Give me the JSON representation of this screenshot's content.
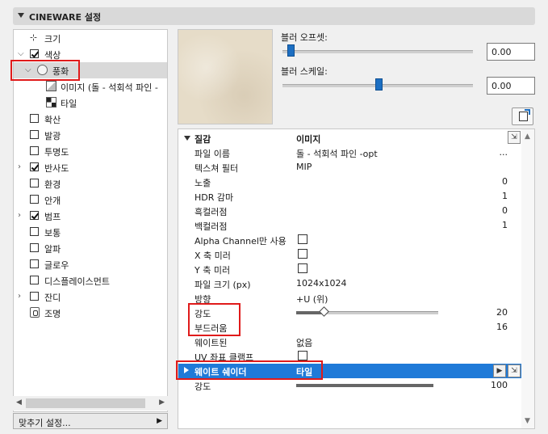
{
  "header": {
    "title": "CINEWARE 설정"
  },
  "tree": {
    "items": [
      {
        "label": "크기",
        "icon": "resize-icon",
        "checkbox": null,
        "expand": null
      },
      {
        "label": "색상",
        "icon": null,
        "checkbox": true,
        "expand": "expanded"
      },
      {
        "label": "풍화",
        "icon": "radio-icon",
        "checkbox": null,
        "expand": "expanded",
        "selected": true
      },
      {
        "label": "이미지 (돌 - 석회석 파인 -",
        "icon": "texture-icon",
        "checkbox": null,
        "expand": null
      },
      {
        "label": "타일",
        "icon": "tile-icon",
        "checkbox": null,
        "expand": null
      },
      {
        "label": "확산",
        "checkbox": false
      },
      {
        "label": "발광",
        "checkbox": false
      },
      {
        "label": "투명도",
        "checkbox": false
      },
      {
        "label": "반사도",
        "checkbox": true,
        "expand": "collapsed"
      },
      {
        "label": "환경",
        "checkbox": false
      },
      {
        "label": "안개",
        "checkbox": false
      },
      {
        "label": "범프",
        "checkbox": true,
        "expand": "collapsed"
      },
      {
        "label": "보통",
        "checkbox": false
      },
      {
        "label": "알파",
        "checkbox": false
      },
      {
        "label": "글로우",
        "checkbox": false
      },
      {
        "label": "디스플레이스먼트",
        "checkbox": false
      },
      {
        "label": "잔디",
        "checkbox": false,
        "expand": "collapsed"
      },
      {
        "label": "조명",
        "icon": "lock-icon"
      }
    ]
  },
  "fit_button": {
    "label": "맞추기 설정..."
  },
  "blur_offset": {
    "label": "블러 오프셋:",
    "value": "0.00",
    "level": 0.0
  },
  "blur_scale": {
    "label": "블러 스케일:",
    "value": "0.00",
    "level": 0.5
  },
  "table": {
    "header": {
      "col1": "질감",
      "col2": "이미지"
    },
    "rows": [
      {
        "name": "파일 이름",
        "value": "돌 - 석회석 파인 -opt",
        "right": "..."
      },
      {
        "name": "텍스쳐 필터",
        "value": "MIP",
        "right": ""
      },
      {
        "name": "노출",
        "value": "",
        "right": "0"
      },
      {
        "name": "HDR 감마",
        "value": "",
        "right": "1"
      },
      {
        "name": "흑컬러점",
        "value": "",
        "right": "0"
      },
      {
        "name": "백컬러점",
        "value": "",
        "right": "1"
      },
      {
        "name": "Alpha Channel만 사용",
        "check": false
      },
      {
        "name": "X 축 미러",
        "check": false
      },
      {
        "name": "Y 축 미러",
        "check": false
      },
      {
        "name": "파일 크기 (px)",
        "value": "1024x1024",
        "right": ""
      },
      {
        "name": "방향",
        "value": "+U (위)",
        "right": ""
      },
      {
        "name": "강도",
        "slider": 0.2,
        "right": "20"
      },
      {
        "name": "부드러움",
        "value": "",
        "right": "16"
      },
      {
        "name": "웨이트된",
        "value": "없음",
        "right": ""
      },
      {
        "name": "UV 좌표 클램프",
        "check": false
      }
    ],
    "weight_shader": {
      "name": "웨이트 쉐이더",
      "value": "타일"
    },
    "strength2": {
      "name": "강도",
      "slider": 1.0,
      "right": "100"
    }
  }
}
